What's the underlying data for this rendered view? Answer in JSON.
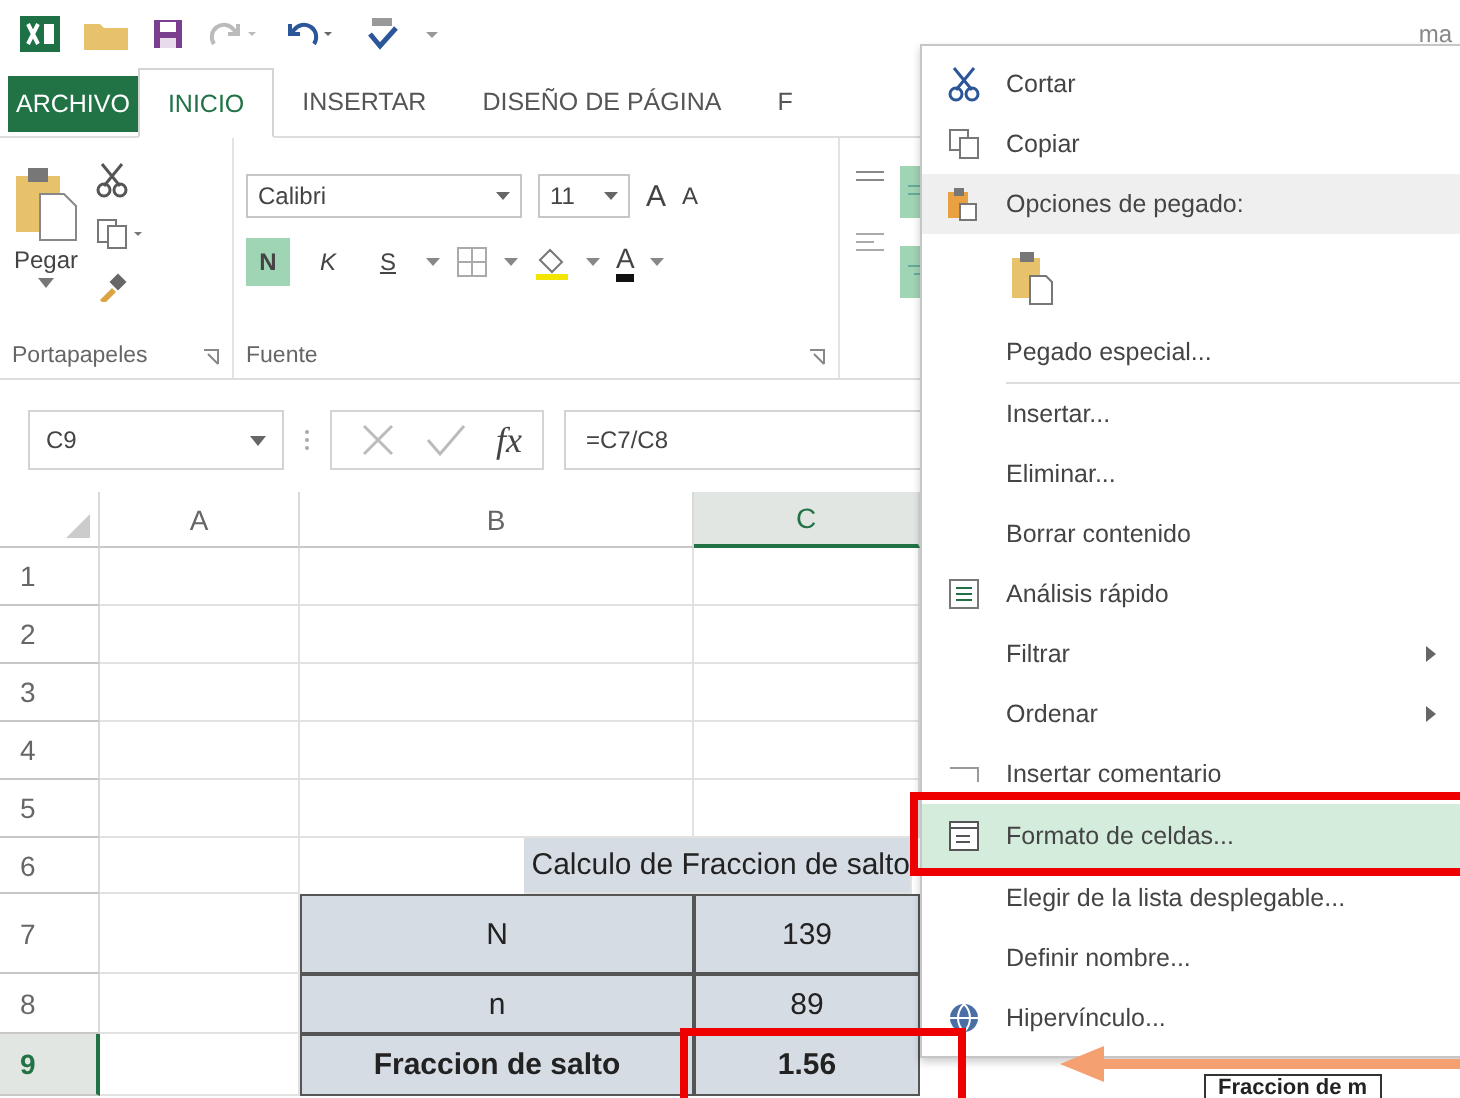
{
  "title_fragment": "ma",
  "tabs": [
    {
      "label": "ARCHIVO",
      "kind": "file",
      "selected": false
    },
    {
      "label": "INICIO",
      "kind": "tab",
      "selected": true
    },
    {
      "label": "INSERTAR",
      "kind": "tab",
      "selected": false
    },
    {
      "label": "DISEÑO DE PÁGINA",
      "kind": "tab",
      "selected": false
    },
    {
      "label": "F",
      "kind": "tab",
      "selected": false
    }
  ],
  "ribbon": {
    "clipboard": {
      "paste_label": "Pegar",
      "group_label": "Portapapeles"
    },
    "font": {
      "font_name": "Calibri",
      "font_size": "11",
      "grow": "A",
      "shrink": "A",
      "bold": "N",
      "italic": "K",
      "underline": "S",
      "font_color": "A",
      "group_label": "Fuente",
      "bold_on": true
    }
  },
  "formula_bar": {
    "name_box": "C9",
    "function_label": "fx",
    "formula": "=C7/C8"
  },
  "sheet": {
    "columns": [
      {
        "label": "A",
        "selected": false
      },
      {
        "label": "B",
        "selected": false
      },
      {
        "label": "C",
        "selected": true
      }
    ],
    "rows": [
      {
        "header": "1",
        "kind": "empty",
        "selected": false
      },
      {
        "header": "2",
        "kind": "empty",
        "selected": false
      },
      {
        "header": "3",
        "kind": "empty",
        "selected": false
      },
      {
        "header": "4",
        "kind": "empty",
        "selected": false
      },
      {
        "header": "5",
        "kind": "empty",
        "selected": false
      },
      {
        "header": "6",
        "kind": "title",
        "selected": false,
        "title": "Calculo de Fraccion de salto"
      },
      {
        "header": "7",
        "kind": "data",
        "selected": false,
        "label": "N",
        "value": "139",
        "bold": false
      },
      {
        "header": "8",
        "kind": "data",
        "selected": false,
        "label": "n",
        "value": "89",
        "bold": false
      },
      {
        "header": "9",
        "kind": "data",
        "selected": true,
        "label": "Fraccion de salto",
        "value": "1.56",
        "bold": true
      }
    ]
  },
  "context_menu": [
    {
      "kind": "item",
      "label": "Cortar",
      "submenu": false,
      "highlighted": false
    },
    {
      "kind": "item",
      "label": "Copiar",
      "submenu": false,
      "highlighted": false
    },
    {
      "kind": "header",
      "label": "Opciones de pegado:"
    },
    {
      "kind": "paste_options"
    },
    {
      "kind": "item",
      "label": "Pegado especial...",
      "submenu": false,
      "highlighted": false
    },
    {
      "kind": "separator"
    },
    {
      "kind": "item",
      "label": "Insertar...",
      "submenu": false,
      "highlighted": false
    },
    {
      "kind": "item",
      "label": "Eliminar...",
      "submenu": false,
      "highlighted": false
    },
    {
      "kind": "item",
      "label": "Borrar contenido",
      "submenu": false,
      "highlighted": false
    },
    {
      "kind": "item",
      "label": "Análisis rápido",
      "submenu": false,
      "highlighted": false
    },
    {
      "kind": "item",
      "label": "Filtrar",
      "submenu": true,
      "highlighted": false
    },
    {
      "kind": "item",
      "label": "Ordenar",
      "submenu": true,
      "highlighted": false
    },
    {
      "kind": "item",
      "label": "Insertar comentario",
      "submenu": false,
      "highlighted": false
    },
    {
      "kind": "item",
      "label": "Formato de celdas...",
      "submenu": false,
      "highlighted": true
    },
    {
      "kind": "item",
      "label": "Elegir de la lista desplegable...",
      "submenu": false,
      "highlighted": false
    },
    {
      "kind": "item",
      "label": "Definir nombre...",
      "submenu": false,
      "highlighted": false
    },
    {
      "kind": "item",
      "label": "Hipervínculo...",
      "submenu": false,
      "highlighted": false
    }
  ],
  "callout": {
    "text": "Fraccion de m"
  }
}
